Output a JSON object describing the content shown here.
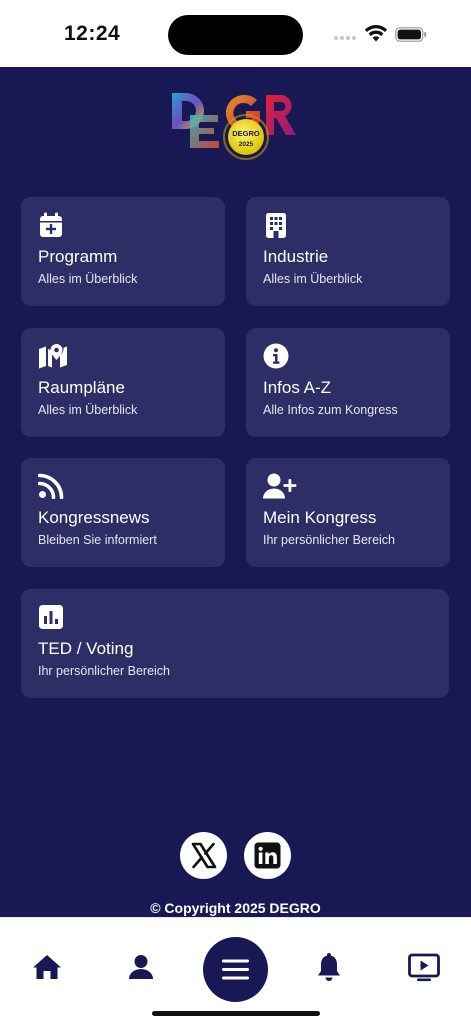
{
  "status": {
    "time": "12:24"
  },
  "colors": {
    "background": "#181854",
    "tile": "#2e2e66",
    "accent": "#ffffff"
  },
  "tiles": [
    {
      "title": "Programm",
      "subtitle": "Alles im Überblick",
      "icon": "calendar-plus-icon"
    },
    {
      "title": "Industrie",
      "subtitle": "Alles im Überblick",
      "icon": "building-icon"
    },
    {
      "title": "Raumpläne",
      "subtitle": "Alles im Überblick",
      "icon": "map-pin-icon"
    },
    {
      "title": "Infos A-Z",
      "subtitle": "Alle Infos zum Kongress",
      "icon": "info-icon"
    },
    {
      "title": "Kongressnews",
      "subtitle": "Bleiben Sie informiert",
      "icon": "rss-icon"
    },
    {
      "title": "Mein Kongress",
      "subtitle": "Ihr persönlicher Bereich",
      "icon": "user-plus-icon"
    },
    {
      "title": "TED / Voting",
      "subtitle": "Ihr persönlicher Bereich",
      "icon": "poll-chart-icon"
    }
  ],
  "social": [
    {
      "icon": "x-logo-icon"
    },
    {
      "icon": "linkedin-logo-icon"
    }
  ],
  "footer": {
    "copyright": "© Copyright 2025 DEGRO"
  },
  "tabbar": {
    "items": [
      {
        "icon": "home-icon"
      },
      {
        "icon": "user-icon"
      },
      {
        "icon": "menu-icon"
      },
      {
        "icon": "bell-icon"
      },
      {
        "icon": "video-play-icon"
      }
    ]
  }
}
